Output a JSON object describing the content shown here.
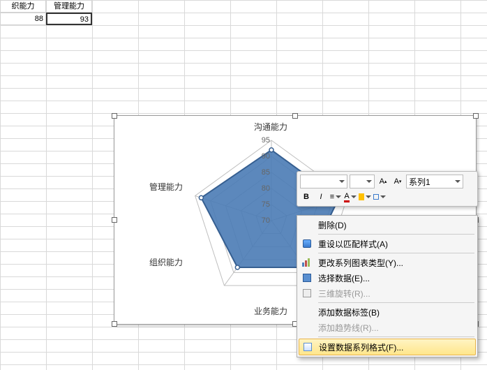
{
  "cells": {
    "h1": "织能力",
    "h2": "管理能力",
    "v1": "88",
    "v2": "93"
  },
  "chart_data": {
    "type": "radar",
    "categories": [
      "沟通能力",
      "管理能力",
      "组织能力",
      "业务能力"
    ],
    "series": [
      {
        "name": "系列1",
        "values": [
          92,
          93,
          88,
          88
        ]
      }
    ],
    "ticks": [
      70,
      75,
      80,
      85,
      90,
      95
    ],
    "rmax": 95,
    "rmin": 70
  },
  "legend": "系列1",
  "toolbar": {
    "series_field": "系列1",
    "btn_bold": "B",
    "btn_italic": "I"
  },
  "ctx": {
    "delete": "删除(D)",
    "reset": "重设以匹配样式(A)",
    "change_type": "更改系列图表类型(Y)...",
    "select_data": "选择数据(E)...",
    "rotate3d": "三维旋转(R)...",
    "add_label": "添加数据标签(B)",
    "add_trend": "添加趋势线(R)...",
    "format": "设置数据系列格式(F)..."
  },
  "axis_labels": {
    "top": "沟通能力",
    "left_upper": "管理能力",
    "left_lower": "组织能力",
    "bottom": "业务能力"
  }
}
